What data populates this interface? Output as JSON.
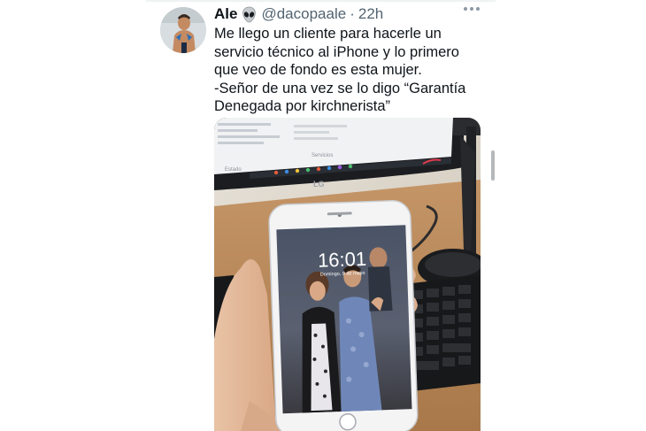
{
  "tweet": {
    "display_name": "Ale",
    "name_emoji": "alien-emoji",
    "handle": "@dacopaale",
    "separator": "·",
    "time": "22h",
    "text_lines": [
      "Me llego un cliente para hacerle un servicio técnico al iPhone y lo primero que veo de fondo es esta mujer.",
      "-Señor de una vez se lo digo “Garantía Denegada por kirchnerista”"
    ]
  },
  "photo": {
    "phone_time": "16:01",
    "phone_date": "Domingo, 9 de mayo",
    "monitor_label": "Estado",
    "monitor_label_2": "Servicios"
  },
  "colors": {
    "text": "#0f1419",
    "secondary": "#536471",
    "wood": "#b98b5a"
  },
  "icons": [
    "more-options-icon",
    "alien-emoji-icon"
  ]
}
